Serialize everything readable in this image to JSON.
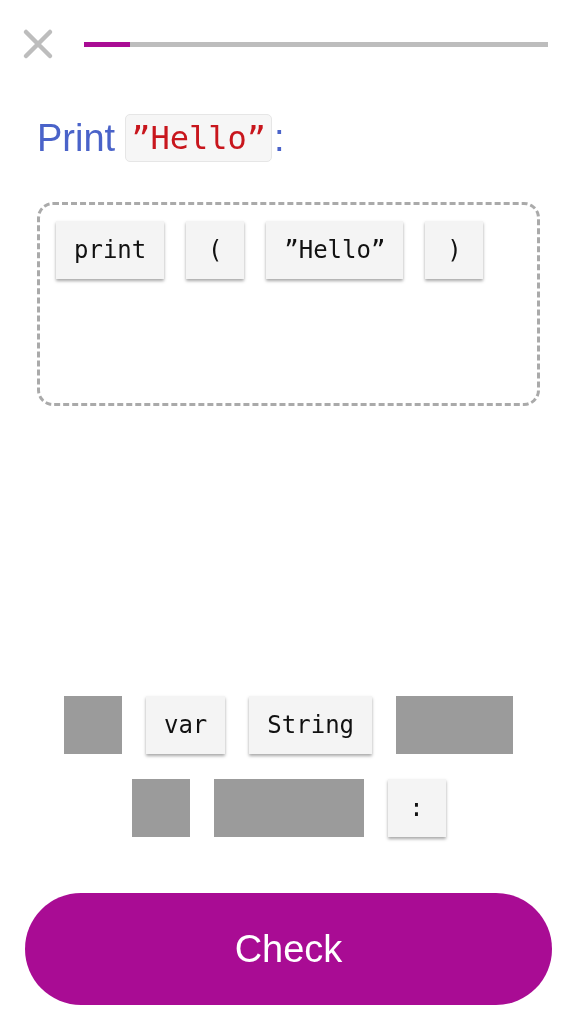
{
  "progress": {
    "level": 0.1
  },
  "prompt": {
    "text": "Print",
    "code": "”Hello”",
    "suffix": ":"
  },
  "answer_tiles": [
    {
      "label": "print"
    },
    {
      "label": "("
    },
    {
      "label": "”Hello”"
    },
    {
      "label": ")"
    }
  ],
  "word_bank": [
    {
      "kind": "short_slot"
    },
    {
      "kind": "tile",
      "label": "var"
    },
    {
      "kind": "tile",
      "label": "String"
    },
    {
      "kind": "mid_slot"
    },
    {
      "kind": "short_slot"
    },
    {
      "kind": "long_slot"
    },
    {
      "kind": "tile",
      "label": ":"
    }
  ],
  "check_button": {
    "label": "Check"
  }
}
